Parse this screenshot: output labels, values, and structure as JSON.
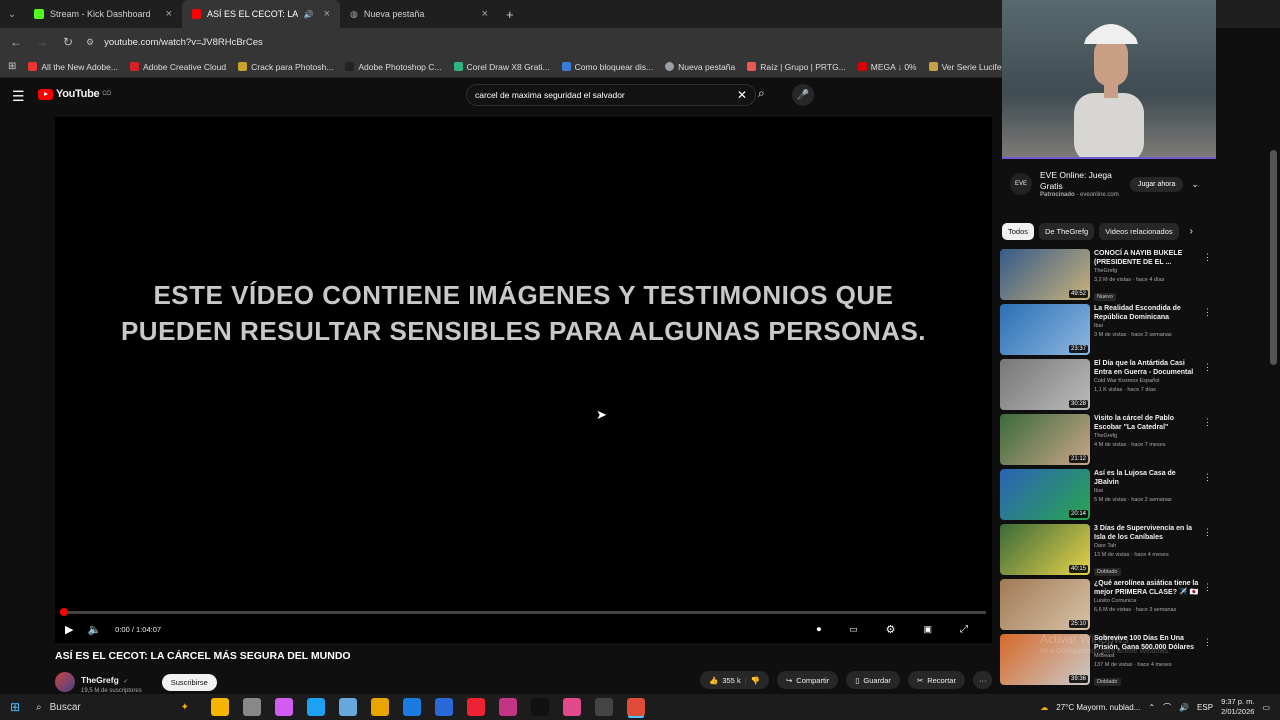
{
  "browser": {
    "tabs": [
      {
        "label": "Stream - Kick Dashboard",
        "color": "#53fc18",
        "active": false
      },
      {
        "label": "ASÍ ES EL CECOT: LA CÁRCE",
        "color": "#ff0000",
        "active": true
      },
      {
        "label": "Nueva pestaña",
        "color": "#9aa0a6",
        "active": false
      }
    ],
    "new_tab": "+",
    "url": "youtube.com/watch?v=JV8RHcBrCes",
    "bookmarks": [
      {
        "label": "All the New Adobe...",
        "color": "#e33"
      },
      {
        "label": "Adobe Creative Cloud",
        "color": "#da1f26"
      },
      {
        "label": "Crack para Photosh...",
        "color": "#c9a227"
      },
      {
        "label": "Adobe Photoshop C...",
        "color": "#222"
      },
      {
        "label": "Corel Draw X8 Grati...",
        "color": "#2cb67d"
      },
      {
        "label": "Como bloquear dis...",
        "color": "#3a7bd5"
      },
      {
        "label": "Nueva pestaña",
        "color": "#9aa0a6"
      },
      {
        "label": "Raíz | Grupo | PRTG...",
        "color": "#e55"
      },
      {
        "label": "MEGA ↓ 0%",
        "color": "#d90007"
      },
      {
        "label": "Ver Serie Lucifer HD...",
        "color": "#c8a04a"
      }
    ]
  },
  "youtube": {
    "logo_text": "YouTube",
    "logo_region": "CO",
    "search_query": "carcel de maxima seguridad el salvador",
    "player": {
      "warning_line1": "ESTE VÍDEO CONTIENE IMÁGENES Y TESTIMONIOS QUE",
      "warning_line2": "PUEDEN RESULTAR SENSIBLES PARA ALGUNAS PERSONAS.",
      "time": "0:00 / 1:04:07",
      "progress": 0.0
    },
    "video_title": "ASÍ ES EL CECOT: LA CÁRCEL MÁS SEGURA DEL MUNDO",
    "channel": {
      "name": "TheGrefg",
      "verified": "✓",
      "subscribers": "19,5 M de suscriptores",
      "subscribe_label": "Suscribirse"
    },
    "actions": {
      "likes": "355 k",
      "share": "Compartir",
      "save": "Guardar",
      "clip": "Recortar",
      "more": "···"
    },
    "ad": {
      "logo": "EVE",
      "title": "EVE Online: Juega Gratis",
      "sponsored": "Patrocinado",
      "domain": "· eveonline.com",
      "cta": "Jugar ahora"
    },
    "chips": [
      "Todos",
      "De TheGrefg",
      "Videos relacionados"
    ],
    "related": [
      {
        "title": "CONOCÍ A NAYIB BUKELE (PRESIDENTE DE EL ...",
        "channel": "TheGrefg",
        "meta": "3,2 M de vistas · hace 4 días",
        "badge": "Nuevo",
        "duration": "49:52",
        "c1": "#355a8a",
        "c2": "#c9b27a"
      },
      {
        "title": "La Realidad Escondida de República Dominicana",
        "channel": "Ibai",
        "meta": "3 M de vistas · hace 2 semanas",
        "badge": "",
        "duration": "23:37",
        "c1": "#2a6fb5",
        "c2": "#8fb7e0"
      },
      {
        "title": "El Día que la Antártida Casi Entra en Guerra - Documental",
        "channel": "Cold War Kosmos Español",
        "meta": "1,1 K vistas · hace 7 días",
        "badge": "",
        "duration": "30:28",
        "c1": "#777",
        "c2": "#bbb"
      },
      {
        "title": "Visito la cárcel de Pablo Escobar \"La Catedral\"",
        "channel": "TheGrefg",
        "meta": "4 M de vistas · hace 7 meses",
        "badge": "",
        "duration": "21:12",
        "c1": "#3b6b3b",
        "c2": "#c9a58a"
      },
      {
        "title": "Así es la Lujosa Casa de JBalvin",
        "channel": "Ibai",
        "meta": "5 M de vistas · hace 2 semanas",
        "badge": "",
        "duration": "20:14",
        "c1": "#2b63b8",
        "c2": "#2aa44f"
      },
      {
        "title": "3 Días de Supervivencia en la Isla de los Caníbales",
        "channel": "Dare Tah",
        "meta": "13 M de vistas · hace 4 meses",
        "badge": "Doblado",
        "duration": "40:15",
        "c1": "#3a6a3a",
        "c2": "#e8d24a"
      },
      {
        "title": "¿Qué aerolínea asiática tiene la mejor PRIMERA CLASE? ✈️ 🇯🇵",
        "channel": "Luisito Comunica",
        "meta": "6,6 M de vistas · hace 3 semanas",
        "badge": "",
        "duration": "25:10",
        "c1": "#a07a55",
        "c2": "#d8c2a8"
      },
      {
        "title": "Sobrevive 100 Días En Una Prisión, Gana 500.000 Dólares",
        "channel": "MrBeast",
        "meta": "137 M de vistas · hace 4 meses",
        "badge": "Doblado",
        "duration": "39:36",
        "c1": "#d86a2a",
        "c2": "#c9c9c9"
      }
    ],
    "watermark_line1": "Activar Windows",
    "watermark_line2": "Ve a Configuración para activar Windows."
  },
  "taskbar": {
    "search": "Buscar",
    "weather": "27°C  Mayorm. nublad...",
    "lang": "ESP",
    "time": "9:37 p. m.",
    "date": "2/01/2026",
    "apps": [
      "#f5b400",
      "#888",
      "#d35cf0",
      "#1da1f2",
      "#6ad",
      "#e8a400",
      "#1c7be0",
      "#2a6ad8",
      "#e23",
      "#c13584",
      "#111",
      "#e14b8c",
      "#444",
      "#dd4b39"
    ]
  }
}
